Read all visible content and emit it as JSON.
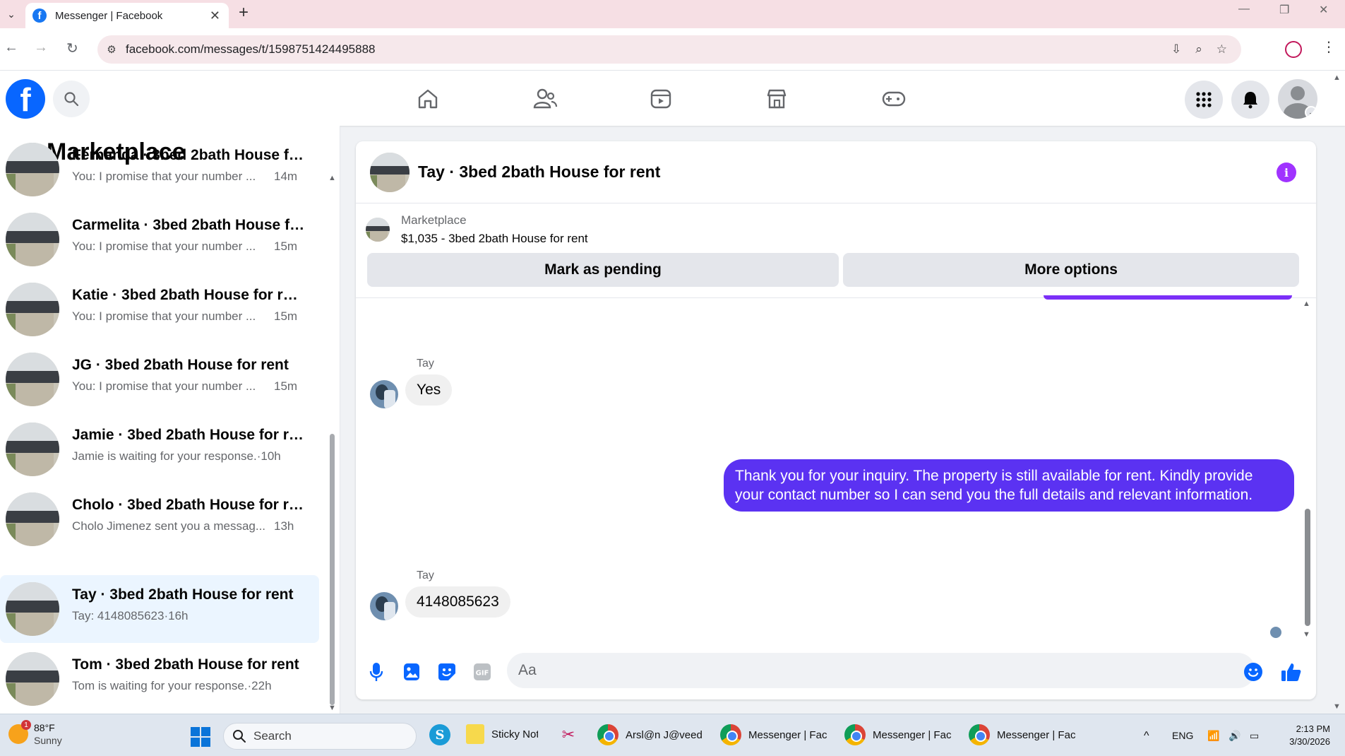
{
  "browser": {
    "tab_title": "Messenger | Facebook",
    "url": "facebook.com/messages/t/1598751424495888"
  },
  "sidebar": {
    "title": "Marketplace",
    "conversations": [
      {
        "name": "Fernanda · 3bed 2bath House fo...",
        "snippet": "You: I promise that your number ...",
        "time": "14m"
      },
      {
        "name": "Carmelita · 3bed 2bath House fo...",
        "snippet": "You: I promise that your number ...",
        "time": "15m"
      },
      {
        "name": "Katie · 3bed 2bath House for rent",
        "snippet": "You: I promise that your number ...",
        "time": "15m"
      },
      {
        "name": "JG · 3bed 2bath House for rent",
        "snippet": "You: I promise that your number ...",
        "time": "15m"
      },
      {
        "name": "Jamie · 3bed 2bath House for rent",
        "snippet": "Jamie is waiting for your response.·10h",
        "time": ""
      },
      {
        "name": "Cholo · 3bed 2bath House for rent",
        "snippet": "Cholo Jimenez sent you a messag...",
        "time": "13h"
      },
      {
        "name": "Tay · 3bed 2bath House for rent",
        "snippet": "Tay: 4148085623·16h",
        "time": ""
      },
      {
        "name": "Tom · 3bed 2bath House for rent",
        "snippet": "Tom is waiting for your response.·22h",
        "time": ""
      }
    ]
  },
  "chat": {
    "title": "Tay · 3bed 2bath House for rent",
    "listing_label": "Marketplace",
    "listing_price": "$1,035 - 3bed 2bath House for rent",
    "mark_pending": "Mark as pending",
    "more_options": "More options",
    "messages": [
      {
        "sender": "Tay",
        "text": "Yes"
      },
      {
        "text": "Thank you for your inquiry. The property is still available for rent. Kindly provide your contact number so I can send you the full details and relevant information."
      },
      {
        "sender": "Tay",
        "text": "4148085623"
      }
    ],
    "input_placeholder": "Aa"
  },
  "taskbar": {
    "weather_temp": "88°F",
    "weather_desc": "Sunny",
    "weather_badge": "1",
    "search_label": "Search",
    "apps": [
      "Sticky Not",
      "Arsl@n J@veed",
      "Messenger | Face",
      "Messenger | Face",
      "Messenger | Face"
    ],
    "lang": "ENG",
    "time": "2:13 PM",
    "date": "3/30/2026"
  },
  "colors": {
    "fb_blue": "#0866ff",
    "outgoing_bubble": "#5b32f2",
    "info_purple": "#a033ff"
  }
}
